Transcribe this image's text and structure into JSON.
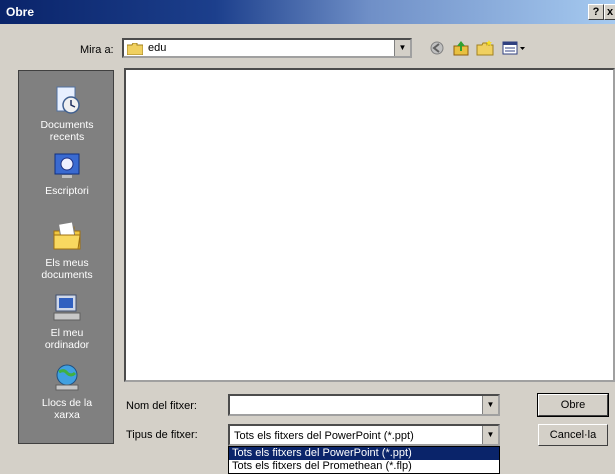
{
  "dialog": {
    "title": "Obre",
    "help_button": "?",
    "close_button": "x"
  },
  "lookin": {
    "label": "Mira a:",
    "value": "edu"
  },
  "places": [
    {
      "label_line1": "Documents",
      "label_line2": "recents",
      "icon": "recent-documents-icon"
    },
    {
      "label_line1": "Escriptori",
      "label_line2": "",
      "icon": "desktop-icon"
    },
    {
      "label_line1": "Els meus",
      "label_line2": "documents",
      "icon": "my-documents-icon"
    },
    {
      "label_line1": "El meu",
      "label_line2": "ordinador",
      "icon": "my-computer-icon"
    },
    {
      "label_line1": "Llocs de la",
      "label_line2": "xarxa",
      "icon": "network-places-icon"
    }
  ],
  "filename": {
    "label": "Nom del fitxer:",
    "value": ""
  },
  "filetype": {
    "label": "Tipus de fitxer:",
    "value": "Tots els fitxers del PowerPoint (*.ppt)",
    "options": [
      "Tots els fitxers del PowerPoint (*.ppt)",
      "Tots els fitxers del Promethean (*.flp)"
    ]
  },
  "buttons": {
    "open": "Obre",
    "cancel": "Cancel·la"
  },
  "colors": {
    "title_gradient_start": "#0a246a",
    "title_gradient_end": "#a6caf0",
    "face": "#d4d0c8",
    "places_bar": "#808080",
    "selection": "#0a246a"
  }
}
